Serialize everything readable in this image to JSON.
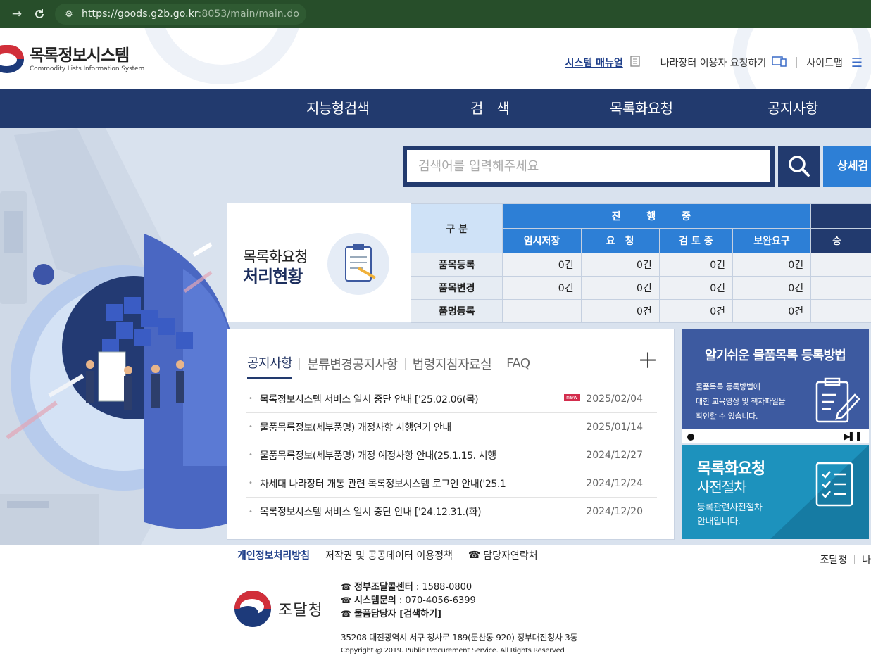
{
  "browser": {
    "url_main": "https://goods.g2b.go.kr",
    "url_dim": ":8053/main/main.do"
  },
  "header": {
    "logo_title": "목록정보시스템",
    "logo_sub": "Commodity Lists Information System",
    "util": {
      "manual": "시스템 매뉴얼",
      "request": "나라장터 이용자 요청하기",
      "sitemap": "사이트맵"
    }
  },
  "gnb": [
    "지능형검색",
    "검　색",
    "목록화요청",
    "공지사항"
  ],
  "search": {
    "placeholder": "검색어를 입력해주세요",
    "detail_label": "상세검"
  },
  "status": {
    "title_line1": "목록화요청",
    "title_line2": "처리현황",
    "gubun": "구 분",
    "in_progress": "진 행 중",
    "approved_head": "승",
    "sub_headers": [
      "임시저장",
      "요　청",
      "검 토 중",
      "보완요구"
    ],
    "rows": [
      {
        "label": "품목등록",
        "values": [
          "0건",
          "0건",
          "0건",
          "0건"
        ]
      },
      {
        "label": "품목변경",
        "values": [
          "0건",
          "0건",
          "0건",
          "0건"
        ]
      },
      {
        "label": "품명등록",
        "values": [
          "",
          "0건",
          "0건",
          "0건"
        ]
      }
    ]
  },
  "notice": {
    "tabs": [
      "공지사항",
      "분류변경공지사항",
      "법령지침자료실",
      "FAQ"
    ],
    "items": [
      {
        "title": "목록정보시스템 서비스 일시 중단 안내 ['25.02.06(목)",
        "date": "2025/02/04",
        "new": "new"
      },
      {
        "title": "물품목록정보(세부품명) 개정사항 시행연기 안내",
        "date": "2025/01/14",
        "new": ""
      },
      {
        "title": "물품목록정보(세부품명) 개정 예정사항 안내(25.1.15. 시행",
        "date": "2024/12/27",
        "new": ""
      },
      {
        "title": "차세대 나라장터 개통 관련 목록정보시스템 로그인 안내('25.1",
        "date": "2024/12/24",
        "new": ""
      },
      {
        "title": "목록정보시스템 서비스 일시 중단 안내 ['24.12.31.(화)",
        "date": "2024/12/20",
        "new": ""
      }
    ]
  },
  "banner1": {
    "title": "알기쉬운 물품목록 등록방법",
    "desc1": "물품목록 등록방법에",
    "desc2": "대한 교육영상 및 책자파일을",
    "desc3": "확인할 수 있습니다."
  },
  "banner2": {
    "title1": "목록화요청",
    "title2": "사전절차",
    "desc1": "등록관련사전절차",
    "desc2": "안내입니다."
  },
  "footer": {
    "privacy": "개인정보처리방침",
    "copyright_policy": "저작권 및 공공데이터 이용정책",
    "contacts_link": "담당자연락처",
    "right1": "조달청",
    "right2": "나",
    "org_name": "조달청",
    "call_label": "정부조달콜센터",
    "call_num": " : 1588-0800",
    "sys_label": "시스템문의",
    "sys_num": " : 070-4056-6399",
    "goods_label": "물품담당자 [검색하기]",
    "address": "35208 대전광역시 서구 청사로 189(둔산동 920) 정부대전청사 3동",
    "copy": "Copyright @ 2019. Public Procurement Service. All Rights Reserved"
  },
  "colors": {
    "navy": "#223a6e",
    "blue": "#2d7fd6",
    "teal": "#1d92bd",
    "bg": "#d9e2ee"
  }
}
